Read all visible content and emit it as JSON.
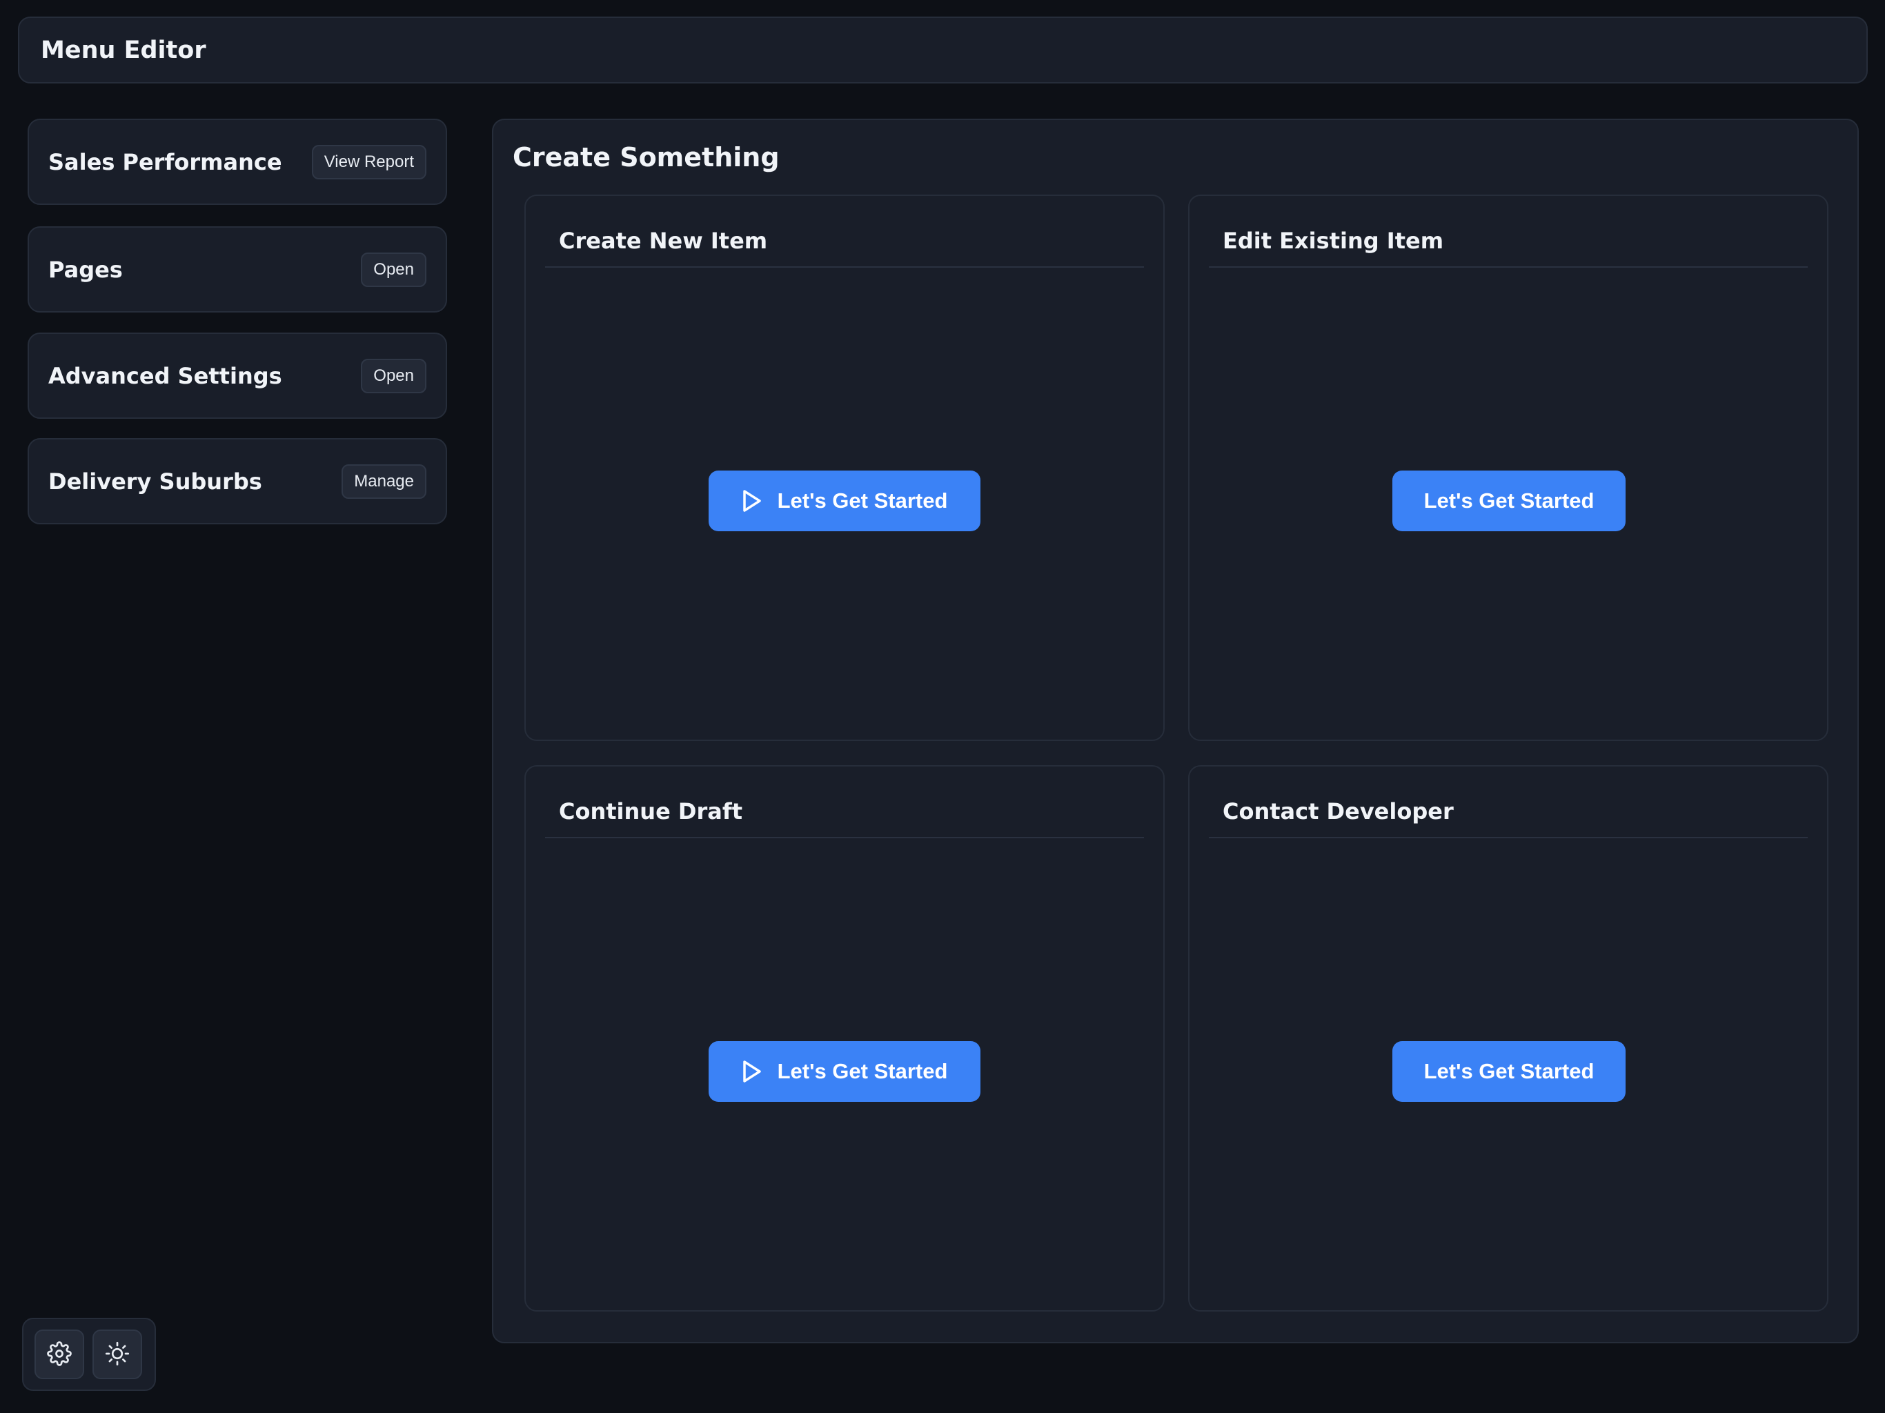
{
  "header": {
    "title": "Menu Editor"
  },
  "sidebar": {
    "cards": [
      {
        "title": "Sales Performance",
        "button": "View Report"
      },
      {
        "title": "Pages",
        "button": "Open"
      },
      {
        "title": "Advanced Settings",
        "button": "Open"
      },
      {
        "title": "Delivery Suburbs",
        "button": "Manage"
      }
    ]
  },
  "main": {
    "title": "Create Something",
    "cards": [
      {
        "title": "Create New Item",
        "button": "Let's Get Started",
        "button_icon": "play-icon"
      },
      {
        "title": "Edit Existing Item",
        "button": "Let's Get Started"
      },
      {
        "title": "Continue Draft",
        "button": "Let's Get Started",
        "button_icon": "play-icon"
      },
      {
        "title": "Contact Developer",
        "button": "Let's Get Started"
      }
    ]
  },
  "toolbar": {
    "icons": [
      "gear-icon",
      "sun-icon"
    ]
  },
  "colors": {
    "accent": "#3b82f6",
    "background": "#0d1016",
    "surface": "#191e29"
  }
}
